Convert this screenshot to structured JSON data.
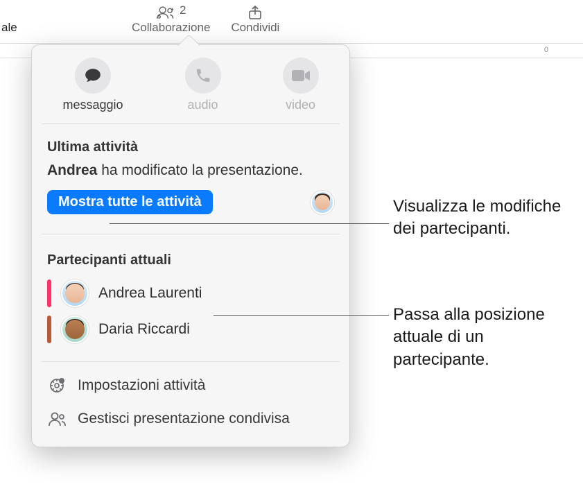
{
  "toolbar": {
    "collab_label": "Collaborazione",
    "collab_count": "2",
    "share_label": "Condividi",
    "partial_label": "ale",
    "ruler_tick": "0"
  },
  "popover": {
    "comm": {
      "message": "messaggio",
      "audio": "audio",
      "video": "video"
    },
    "activity": {
      "title": "Ultima attività",
      "actor": "Andrea",
      "suffix": " ha modificato la presentazione.",
      "show_all": "Mostra tutte le attività"
    },
    "participants": {
      "title": "Partecipanti attuali",
      "list": [
        {
          "name": "Andrea Laurenti",
          "color": "#ff3367"
        },
        {
          "name": "Daria Riccardi",
          "color": "#b85a3a"
        }
      ]
    },
    "footer": {
      "settings": "Impostazioni attività",
      "manage": "Gestisci presentazione condivisa"
    }
  },
  "callouts": {
    "c1": "Visualizza le modifiche dei partecipanti.",
    "c2": "Passa alla posizione attuale di un partecipante."
  }
}
